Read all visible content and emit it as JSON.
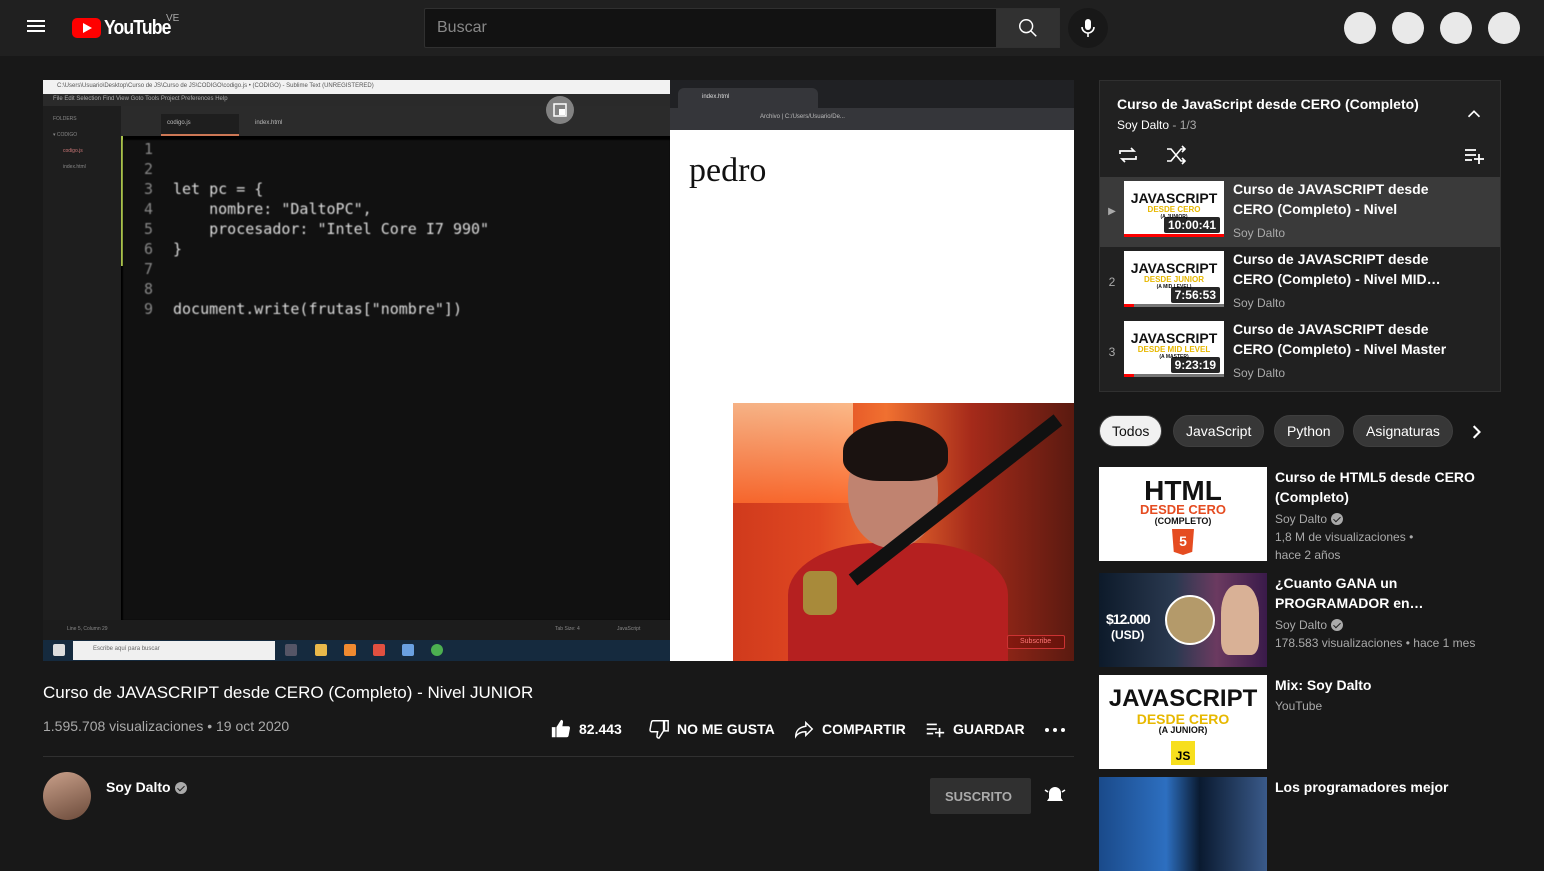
{
  "header": {
    "logo_text": "YouTube",
    "country_code": "VE",
    "search_placeholder": "Buscar"
  },
  "player": {
    "editor_title": "C:\\Users\\Usuario\\Desktop\\Curso de JS\\Curso de JS\\CODIGO\\codigo.js • (CODIGO) - Sublime Text (UNREGISTERED)",
    "editor_menu": "File  Edit  Selection  Find  View  Goto  Tools  Project  Preferences  Help",
    "editor_sidebar_items": [
      "FOLDERS",
      "▾ CODIGO",
      "codigo.js",
      "index.html"
    ],
    "editor_tabs": [
      "codigo.js",
      "index.html"
    ],
    "code_lines": [
      {
        "n": "1",
        "text": ""
      },
      {
        "n": "2",
        "text": ""
      },
      {
        "n": "3",
        "text": "let pc = {"
      },
      {
        "n": "4",
        "text": "    nombre: \"DaltoPC\","
      },
      {
        "n": "5",
        "text": "    procesador: \"Intel Core I7 990\""
      },
      {
        "n": "6",
        "text": "}"
      },
      {
        "n": "7",
        "text": ""
      },
      {
        "n": "8",
        "text": ""
      },
      {
        "n": "9",
        "text": "document.write(frutas[\"nombre\"])"
      }
    ],
    "editor_status_left": "Line 5, Column 29",
    "editor_status_tab": "Tab Size: 4",
    "editor_status_syntax": "JavaScript",
    "taskbar_search": "Escribe aquí para buscar",
    "browser_tab": "index.html",
    "browser_url": "Archivo | C:/Users/Usuario/De...",
    "page_text": "pedro",
    "watermark": "Subscribe"
  },
  "video": {
    "title": "Curso de JAVASCRIPT desde CERO (Completo) - Nivel JUNIOR",
    "views_date": "1.595.708 visualizaciones • 19 oct 2020",
    "like_count": "82.443",
    "dislike_label": "NO ME GUSTA",
    "share_label": "COMPARTIR",
    "save_label": "GUARDAR"
  },
  "channel": {
    "name": "Soy Dalto",
    "subscribed_label": "SUSCRITO"
  },
  "playlist": {
    "title": "Curso de JavaScript desde CERO (Completo)",
    "channel": "Soy Dalto",
    "position": " - 1/3",
    "items": [
      {
        "index": "▶",
        "title": "Curso de JAVASCRIPT desde CERO (Completo) - Nivel JUNIOR",
        "channel": "Soy Dalto",
        "duration": "10:00:41",
        "thumb_top": "JAVASCRIPT",
        "thumb_mid": "DESDE CERO",
        "thumb_bot": "(A JUNIOR)",
        "progress": 1.0
      },
      {
        "index": "2",
        "title": "Curso de JAVASCRIPT desde CERO (Completo) - Nivel MID…",
        "channel": "Soy Dalto",
        "duration": "7:56:53",
        "thumb_top": "JAVASCRIPT",
        "thumb_mid": "DESDE JUNIOR",
        "thumb_bot": "(A MID LEVEL)",
        "progress": 0.1
      },
      {
        "index": "3",
        "title": "Curso de JAVASCRIPT desde CERO (Completo) - Nivel Master",
        "channel": "Soy Dalto",
        "duration": "9:23:19",
        "thumb_top": "JAVASCRIPT",
        "thumb_mid": "DESDE MID LEVEL",
        "thumb_bot": "(A MASTER)",
        "progress": 0.1
      }
    ]
  },
  "chips": [
    "Todos",
    "JavaScript",
    "Python",
    "Asignaturas"
  ],
  "recommendations": [
    {
      "title": "Curso de HTML5 desde CERO (Completo)",
      "channel": "Soy Dalto",
      "line2": "1,8 M de visualizaciones •",
      "line3": "hace 2 años",
      "thumb_top": "HTML",
      "thumb_mid": "DESDE CERO",
      "thumb_bot": "(COMPLETO)",
      "badge": "5"
    },
    {
      "title": "¿Cuanto GANA un PROGRAMADOR en…",
      "channel": "Soy Dalto",
      "line2": "178.583 visualizaciones • hace 1 mes",
      "line3": "",
      "thumb_price": "$12.000",
      "thumb_currency": "(USD)"
    },
    {
      "title": "Mix: Soy Dalto",
      "channel": "YouTube",
      "line2": "",
      "line3": "",
      "thumb_top": "JAVASCRIPT",
      "thumb_mid": "DESDE CERO",
      "thumb_bot": "(A JUNIOR)",
      "badge": "JS"
    },
    {
      "title": "Los programadores mejor",
      "channel": "",
      "line2": "",
      "line3": ""
    }
  ],
  "colors": {
    "accent": "#ff0000",
    "background": "#181818",
    "chip_active": "#f1f1f1"
  }
}
